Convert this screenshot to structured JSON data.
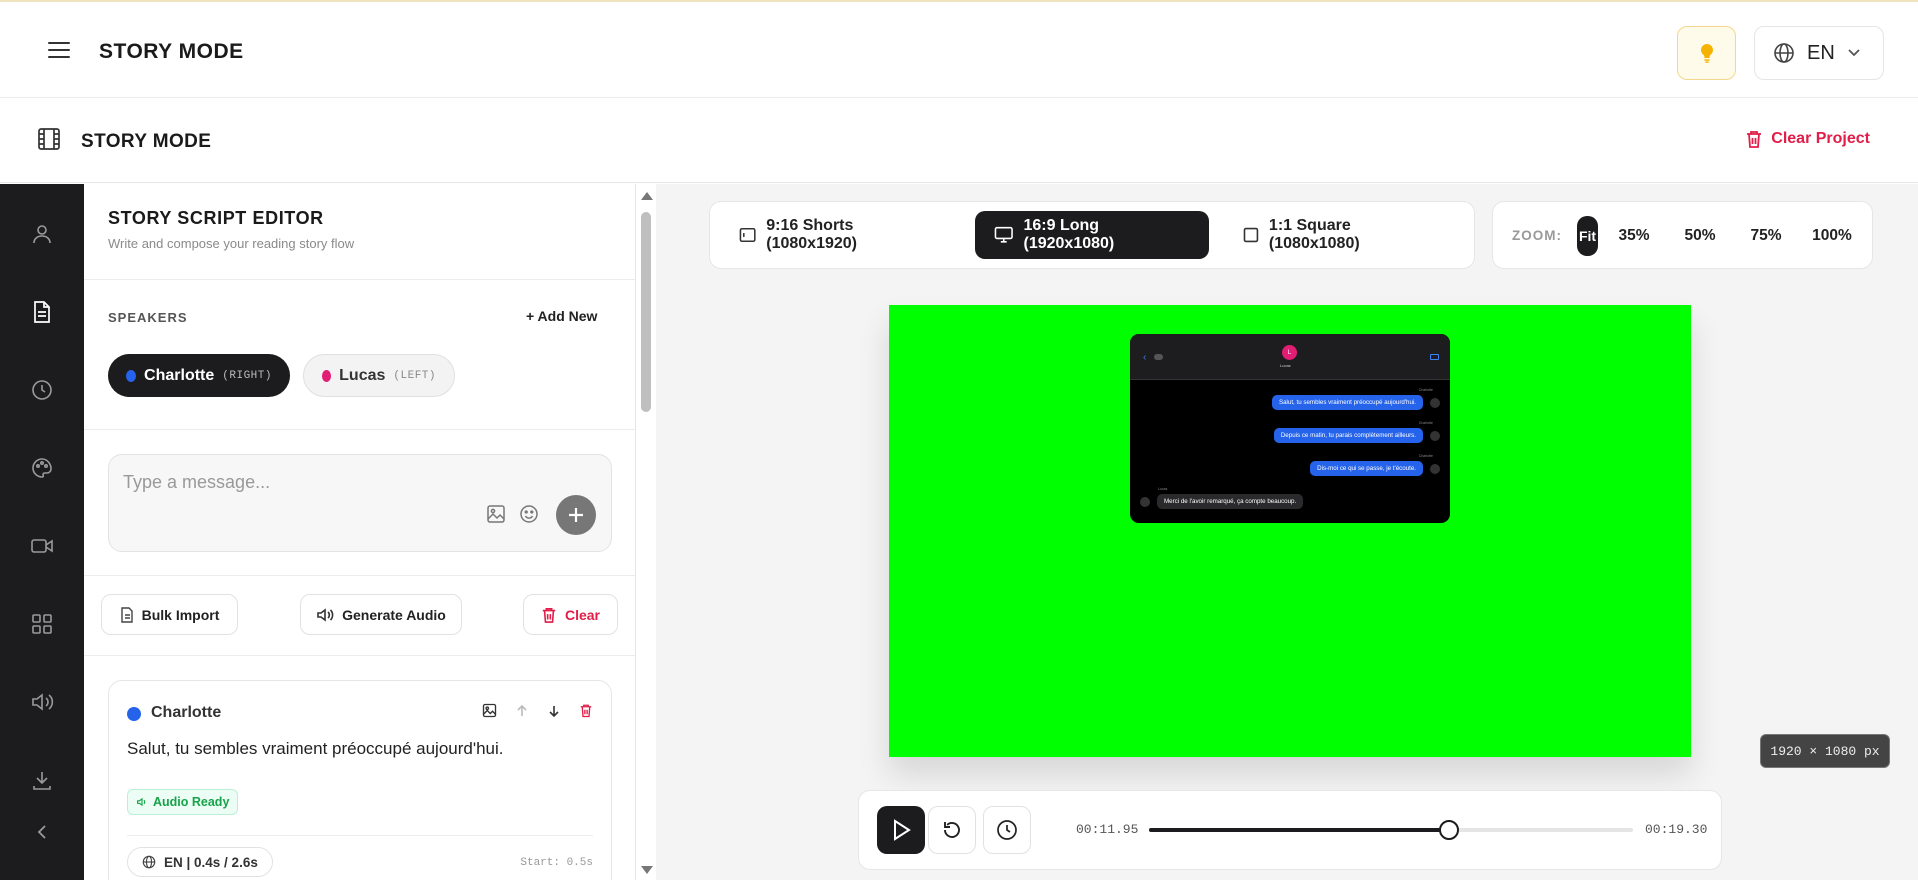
{
  "app": {
    "brand": "STORY MODE",
    "language": "EN"
  },
  "subheader": {
    "title": "STORY MODE",
    "clear_project": "Clear Project"
  },
  "editor": {
    "title": "STORY SCRIPT EDITOR",
    "subtitle": "Write and compose your reading story flow",
    "speakers_label": "SPEAKERS",
    "add_new": "Add New",
    "speakers": [
      {
        "name": "Charlotte",
        "side": "(RIGHT)",
        "color": "#2563eb",
        "active": true
      },
      {
        "name": "Lucas",
        "side": "(LEFT)",
        "color": "#e11d74",
        "active": false
      }
    ],
    "message_placeholder": "Type a message...",
    "actions": {
      "bulk_import": "Bulk Import",
      "generate_audio": "Generate Audio",
      "clear": "Clear"
    },
    "cards": [
      {
        "speaker": "Charlotte",
        "text": "Salut, tu sembles vraiment préoccupé aujourd'hui.",
        "status": "Audio Ready",
        "lang_info": "EN | 0.4s / 2.6s",
        "start": "Start: 0.5s"
      }
    ]
  },
  "formats": [
    {
      "label": "9:16 Shorts (1080x1920)",
      "active": false
    },
    {
      "label": "16:9 Long (1920x1080)",
      "active": true
    },
    {
      "label": "1:1 Square (1080x1080)",
      "active": false
    }
  ],
  "zoom": {
    "label": "ZOOM:",
    "options": [
      "Fit",
      "35%",
      "50%",
      "75%",
      "100%"
    ],
    "selected": "Fit"
  },
  "canvas": {
    "background": "#00ff00",
    "dimensions": "1920 × 1080 px",
    "chat": {
      "contact_initial": "L",
      "contact_name": "Lucas",
      "messages": [
        {
          "speaker": "Charlotte",
          "text": "Salut, tu sembles vraiment préoccupé aujourd'hui.",
          "side": "right"
        },
        {
          "speaker": "Charlotte",
          "text": "Depuis ce matin, tu parais complètement ailleurs.",
          "side": "right"
        },
        {
          "speaker": "Charlotte",
          "text": "Dis-moi ce qui se passe, je t'écoute.",
          "side": "right"
        },
        {
          "speaker": "Lucas",
          "text": "Merci de l'avoir remarqué, ça compte beaucoup.",
          "side": "left"
        }
      ]
    }
  },
  "player": {
    "current": "00:11.95",
    "total": "00:19.30",
    "progress": 0.619
  },
  "colors": {
    "accent": "#1c1c1e",
    "danger": "#e11d48",
    "success": "#16a34a",
    "speaker_blue": "#2563eb",
    "speaker_pink": "#e11d74"
  }
}
